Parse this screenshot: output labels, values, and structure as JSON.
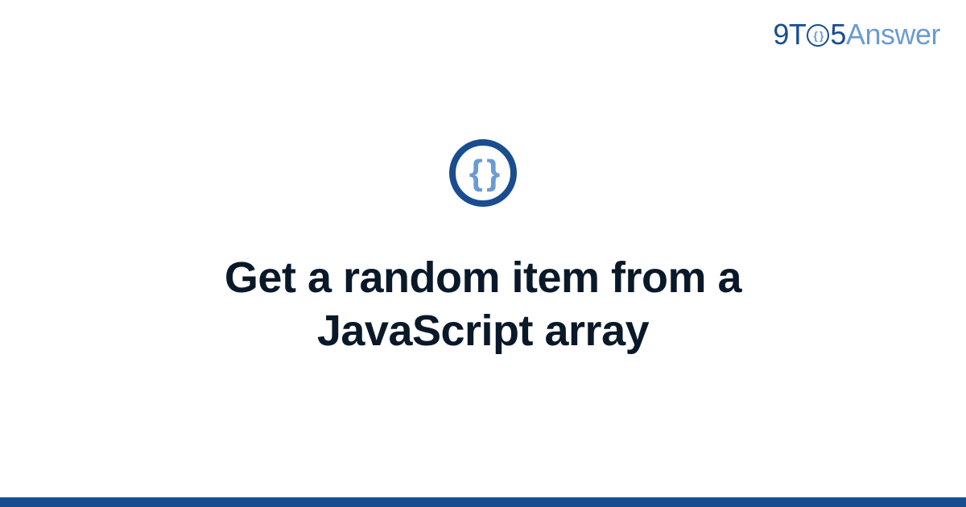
{
  "brand": {
    "part1": "9T",
    "part2": "5",
    "part3": "Answer",
    "icon_content": "{ }"
  },
  "center_icon": {
    "content": "{ }",
    "semantic": "code-braces-icon"
  },
  "title": "Get a random item from a JavaScript array",
  "colors": {
    "brand_dark": "#1a4d8f",
    "brand_light": "#6b9bd1",
    "text": "#0a1929",
    "background": "#ffffff"
  }
}
